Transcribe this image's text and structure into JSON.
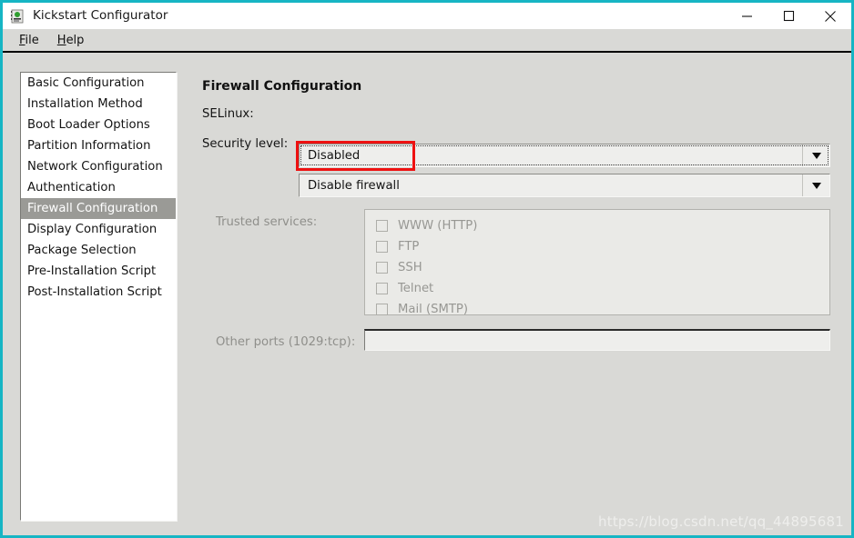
{
  "window": {
    "title": "Kickstart Configurator",
    "icon": "app-icon",
    "controls": {
      "minimize": "minimize-icon",
      "maximize": "maximize-icon",
      "close": "close-icon"
    },
    "accent_color": "#16b5c4",
    "background_color": "#d9d9d6"
  },
  "menubar": {
    "items": [
      {
        "label": "File",
        "mnemonic": "F"
      },
      {
        "label": "Help",
        "mnemonic": "H"
      }
    ]
  },
  "sidebar": {
    "items": [
      {
        "label": "Basic Configuration",
        "selected": false
      },
      {
        "label": "Installation Method",
        "selected": false
      },
      {
        "label": "Boot Loader Options",
        "selected": false
      },
      {
        "label": "Partition Information",
        "selected": false
      },
      {
        "label": "Network Configuration",
        "selected": false
      },
      {
        "label": "Authentication",
        "selected": false
      },
      {
        "label": "Firewall Configuration",
        "selected": true
      },
      {
        "label": "Display Configuration",
        "selected": false
      },
      {
        "label": "Package Selection",
        "selected": false
      },
      {
        "label": "Pre-Installation Script",
        "selected": false
      },
      {
        "label": "Post-Installation Script",
        "selected": false
      }
    ],
    "selected_color": "#9a9a96"
  },
  "main": {
    "title": "Firewall Configuration",
    "selinux": {
      "label": "SELinux:",
      "value": "Disabled",
      "focused": true,
      "highlight_color": "#ee1111",
      "arrow_icon": "chevron-down-icon"
    },
    "security_level": {
      "label": "Security level:",
      "value": "Disable firewall",
      "focused": false,
      "arrow_icon": "chevron-down-icon"
    },
    "trusted_services": {
      "label": "Trusted services:",
      "disabled": true,
      "options": [
        {
          "label": "WWW (HTTP)",
          "checked": false
        },
        {
          "label": "FTP",
          "checked": false
        },
        {
          "label": "SSH",
          "checked": false
        },
        {
          "label": "Telnet",
          "checked": false
        },
        {
          "label": "Mail (SMTP)",
          "checked": false
        }
      ]
    },
    "other_ports": {
      "label": "Other ports (1029:tcp):",
      "value": "",
      "placeholder": ""
    }
  },
  "watermark": {
    "text": "https://blog.csdn.net/qq_44895681"
  }
}
